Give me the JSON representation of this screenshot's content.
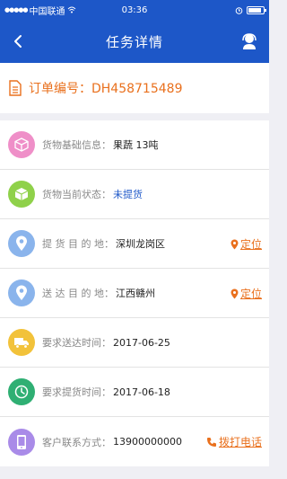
{
  "status_bar": {
    "carrier": "中国联通",
    "time": "03:36",
    "battery_level": 0.9
  },
  "nav": {
    "title": "任务详情",
    "back_icon": "chevron-left-icon",
    "user_icon": "user-service-icon"
  },
  "order": {
    "label": "订单编号：DH458715489",
    "icon": "document-icon"
  },
  "items": [
    {
      "label": "货物基础信息：",
      "value": "果蔬  13吨",
      "icon": "box-icon",
      "color": "#ef8fc8"
    },
    {
      "label": "货物当前状态：",
      "value": "未提货",
      "icon": "cube-icon",
      "color": "#8fd14a",
      "value_color": "blue"
    },
    {
      "label": "提 货 目 的 地：",
      "value": "深圳龙岗区",
      "icon": "location-icon",
      "color": "#8ab4ec",
      "action": "定位"
    },
    {
      "label": "送 达 目 的 地：",
      "value": "江西赣州",
      "icon": "location-icon",
      "color": "#8ab4ec",
      "action": "定位"
    },
    {
      "label": "要求送达时间：",
      "value": "2017-06-25",
      "icon": "truck-icon",
      "color": "#f2c23a"
    },
    {
      "label": "要求提货时间：",
      "value": "2017-06-18",
      "icon": "clock-icon",
      "color": "#2faf73"
    },
    {
      "label": "客户联系方式：",
      "value": "13900000000",
      "icon": "phone-icon",
      "color": "#a98be8",
      "action": "拨打电话"
    }
  ],
  "colors": {
    "primary": "#1d57c8",
    "accent": "#e9701d"
  }
}
